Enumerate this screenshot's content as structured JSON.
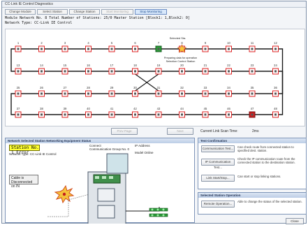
{
  "window": {
    "title": "CC-Link IE Control Diagnostics"
  },
  "tabs": [
    {
      "label": "Change Module",
      "state": "normal"
    },
    {
      "label": "Select Station",
      "state": "normal"
    },
    {
      "label": "Change Station",
      "state": "normal"
    },
    {
      "label": "Start Monitoring",
      "state": "disabled"
    },
    {
      "label": "Stop Monitoring",
      "state": "active"
    }
  ],
  "info": {
    "line1": "Module  Network No. 8  Total Number of Stations:  25/0 Master Station  [Block1:   1,Block2:   0]",
    "line2": "Network Type: CC-Link IE Control"
  },
  "network": {
    "selected_label": "Selected Sta.",
    "connected_label": "Connected Sta.",
    "row1": [
      "1",
      "2",
      "3",
      "4",
      "5",
      "6",
      "7",
      "8",
      "9",
      "10",
      "11",
      "12"
    ],
    "row2": [
      "13",
      "14",
      "15",
      "16",
      "17",
      "18",
      "19",
      "20",
      "21",
      "22",
      "23",
      "24"
    ],
    "row3": [
      "25",
      "26",
      "27",
      "28",
      "29",
      "30",
      "31",
      "32",
      "33",
      "34",
      "35",
      "36"
    ],
    "row4": [
      "37",
      "38",
      "39",
      "40",
      "41",
      "42",
      "43",
      "44",
      "45",
      "46",
      "47",
      "48"
    ],
    "caption_line1": "Preparing data for operation",
    "caption_line2": "Selection Control Station"
  },
  "buttons": {
    "prev": "Prev Page",
    "next": "Next",
    "link_scan_label": "Current Link Scan Time:",
    "link_scan_value": "2ms"
  },
  "left_panel": {
    "title": "Network Selected Station Networking Equipment Status",
    "station_label": "Station No. 1 Error",
    "net_type": "Network Type: CC-Link IE Control",
    "col1_header": "Connect",
    "col1_sub": "Communication Group No. 0",
    "col2_header": "IP Address",
    "col3_header": "Model Online",
    "disconnect_label": "Cable is Disconnected on IN"
  },
  "right_panel": {
    "test_title": "Test Confirmation",
    "comm_test": "Communication Test...",
    "comm_test_desc": "Can check route from connected station to specified dest. station.",
    "ip_comm_test": "IP Communication Test...",
    "ip_comm_test_desc": "Check the IP communication route from the connected station to the destination station.",
    "link_start": "Link Start/Stop...",
    "link_start_desc": "Can start or stop linking stations.",
    "op_title": "Selected Station Operation",
    "remote_op": "Remote Operation...",
    "remote_op_desc": "Able to change the status of the selected station.",
    "close": "Close"
  },
  "colors": {
    "accent": "#1d4d91",
    "station_green": "#2e9e3a",
    "station_red": "#cc2222",
    "cable_dark": "#1a1a1a",
    "cable_red": "#d22"
  }
}
